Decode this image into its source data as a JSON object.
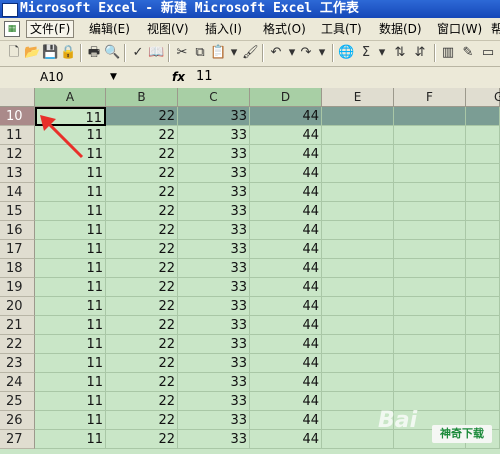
{
  "window": {
    "title": "Microsoft Excel - 新建 Microsoft Excel 工作表"
  },
  "menu": {
    "items": [
      "文件(F)",
      "编辑(E)",
      "视图(V)",
      "插入(I)",
      "格式(O)",
      "工具(T)",
      "数据(D)",
      "窗口(W)",
      "帮"
    ]
  },
  "formula": {
    "cell_ref": "A10",
    "fx_label": "fx",
    "value": "11"
  },
  "sheet": {
    "columns": [
      "A",
      "B",
      "C",
      "D",
      "E",
      "F",
      "G"
    ],
    "selected_row": "10",
    "active_cell": "A10",
    "rows": [
      {
        "num": "10",
        "a": "11",
        "b": "22",
        "c": "33",
        "d": "44"
      },
      {
        "num": "11",
        "a": "11",
        "b": "22",
        "c": "33",
        "d": "44"
      },
      {
        "num": "12",
        "a": "11",
        "b": "22",
        "c": "33",
        "d": "44"
      },
      {
        "num": "13",
        "a": "11",
        "b": "22",
        "c": "33",
        "d": "44"
      },
      {
        "num": "14",
        "a": "11",
        "b": "22",
        "c": "33",
        "d": "44"
      },
      {
        "num": "15",
        "a": "11",
        "b": "22",
        "c": "33",
        "d": "44"
      },
      {
        "num": "16",
        "a": "11",
        "b": "22",
        "c": "33",
        "d": "44"
      },
      {
        "num": "17",
        "a": "11",
        "b": "22",
        "c": "33",
        "d": "44"
      },
      {
        "num": "18",
        "a": "11",
        "b": "22",
        "c": "33",
        "d": "44"
      },
      {
        "num": "19",
        "a": "11",
        "b": "22",
        "c": "33",
        "d": "44"
      },
      {
        "num": "20",
        "a": "11",
        "b": "22",
        "c": "33",
        "d": "44"
      },
      {
        "num": "21",
        "a": "11",
        "b": "22",
        "c": "33",
        "d": "44"
      },
      {
        "num": "22",
        "a": "11",
        "b": "22",
        "c": "33",
        "d": "44"
      },
      {
        "num": "23",
        "a": "11",
        "b": "22",
        "c": "33",
        "d": "44"
      },
      {
        "num": "24",
        "a": "11",
        "b": "22",
        "c": "33",
        "d": "44"
      },
      {
        "num": "25",
        "a": "11",
        "b": "22",
        "c": "33",
        "d": "44"
      },
      {
        "num": "26",
        "a": "11",
        "b": "22",
        "c": "33",
        "d": "44"
      },
      {
        "num": "27",
        "a": "11",
        "b": "22",
        "c": "33",
        "d": "44"
      }
    ]
  },
  "watermark": {
    "site_text": "神奇下载",
    "bai_text": "Bai"
  },
  "colors": {
    "cell_background": "#c9e6c7",
    "selected_row": "#7b9d94",
    "title_bar": "#1f5ac8",
    "annotation_arrow": "#e8302a"
  }
}
